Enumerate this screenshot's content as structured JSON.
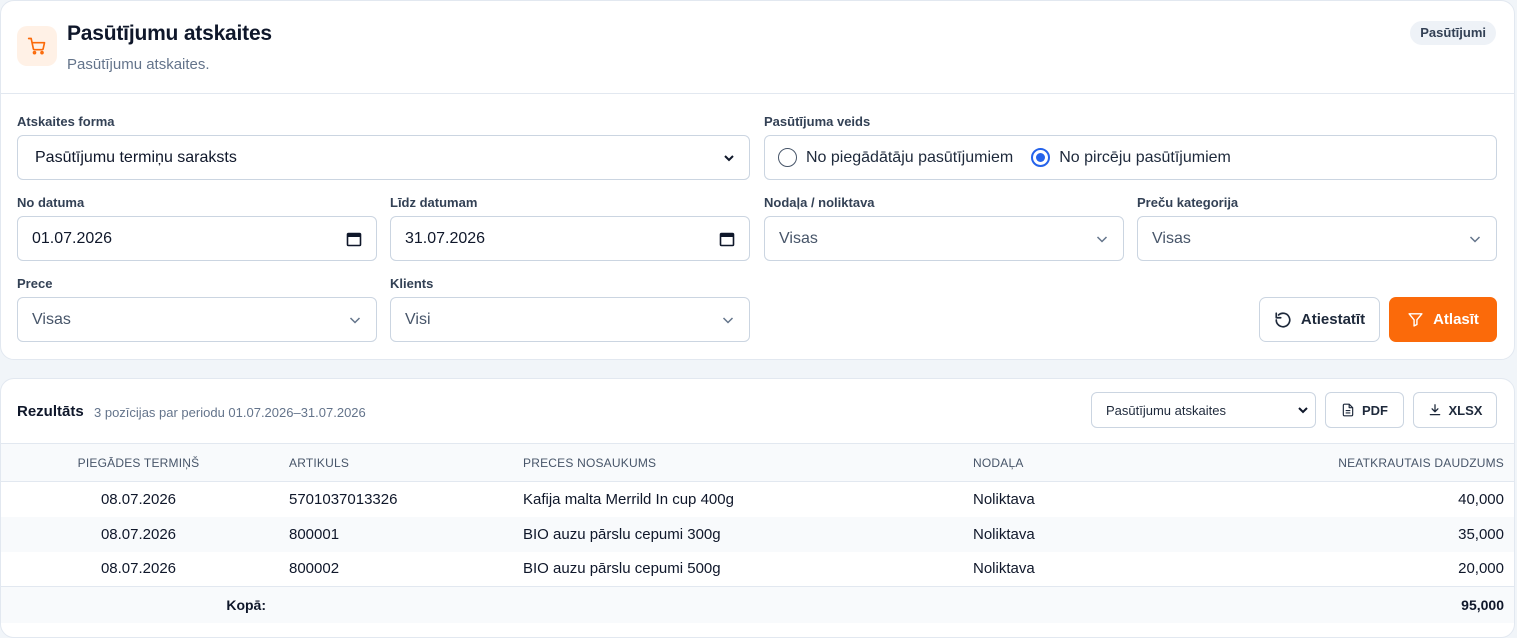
{
  "header": {
    "title": "Pasūtījumu atskaites",
    "subtitle": "Pasūtījumu atskaites.",
    "badge": "Pasūtījumi"
  },
  "filters": {
    "report_form": {
      "label": "Atskaites forma",
      "value": "Pasūtījumu termiņu saraksts"
    },
    "order_type": {
      "label": "Pasūtījuma veids",
      "options": [
        {
          "label": "No piegādātāju pasūtījumiem",
          "selected": false
        },
        {
          "label": "No pircēju pasūtījumiem",
          "selected": true
        }
      ]
    },
    "date_from": {
      "label": "No datuma",
      "value": "01.07.2026"
    },
    "date_to": {
      "label": "Līdz datumam",
      "value": "31.07.2026"
    },
    "department": {
      "label": "Nodaļa / noliktava",
      "value": "Visas"
    },
    "category": {
      "label": "Preču kategorija",
      "value": "Visas"
    },
    "product": {
      "label": "Prece",
      "value": "Visas"
    },
    "client": {
      "label": "Klients",
      "value": "Visi"
    },
    "reset_label": "Atiestatīt",
    "apply_label": "Atlasīt"
  },
  "results": {
    "title": "Rezultāts",
    "info": "3 pozīcijas par periodu 01.07.2026–31.07.2026",
    "view_select": "Pasūtījumu atskaites",
    "pdf_label": "PDF",
    "xlsx_label": "XLSX",
    "columns": [
      "PIEGĀDES TERMIŅŠ",
      "ARTIKULS",
      "PRECES NOSAUKUMS",
      "NODAĻA",
      "NEATKRAUTAIS DAUDZUMS"
    ],
    "rows": [
      [
        "08.07.2026",
        "5701037013326",
        "Kafija malta Merrild In cup 400g",
        "Noliktava",
        "40,000"
      ],
      [
        "08.07.2026",
        "800001",
        "BIO auzu pārslu cepumi 300g",
        "Noliktava",
        "35,000"
      ],
      [
        "08.07.2026",
        "800002",
        "BIO auzu pārslu cepumi 500g",
        "Noliktava",
        "20,000"
      ]
    ],
    "total_label": "Kopā:",
    "total_value": "95,000"
  },
  "colors": {
    "accent": "#fb6a0a",
    "radio": "#2563eb"
  }
}
